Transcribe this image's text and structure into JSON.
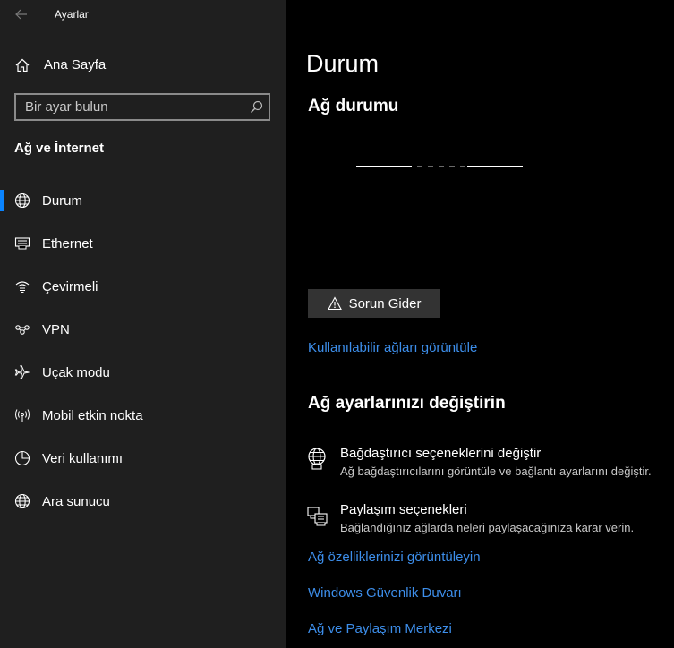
{
  "window": {
    "title": "Ayarlar"
  },
  "sidebar": {
    "home_label": "Ana Sayfa",
    "search": {
      "placeholder": "Bir ayar bulun",
      "value": ""
    },
    "section_title": "Ağ ve İnternet",
    "selected": "Durum",
    "items": [
      {
        "label": "Durum",
        "icon": "globe-icon"
      },
      {
        "label": "Ethernet",
        "icon": "ethernet-icon"
      },
      {
        "label": "Çevirmeli",
        "icon": "dialup-icon"
      },
      {
        "label": "VPN",
        "icon": "vpn-icon"
      },
      {
        "label": "Uçak modu",
        "icon": "airplane-icon"
      },
      {
        "label": "Mobil etkin nokta",
        "icon": "hotspot-icon"
      },
      {
        "label": "Veri kullanımı",
        "icon": "data-usage-icon"
      },
      {
        "label": "Ara sunucu",
        "icon": "proxy-globe-icon"
      }
    ]
  },
  "main": {
    "page_title": "Durum",
    "network_status_title": "Ağ durumu",
    "troubleshoot_label": "Sorun Gider",
    "view_networks_link": "Kullanılabilir ağları görüntüle",
    "change_settings_title": "Ağ ayarlarınızı değiştirin",
    "options": [
      {
        "title": "Bağdaştırıcı seçeneklerini değiştir",
        "description": "Ağ bağdaştırıcılarını görüntüle ve bağlantı ayarlarını değiştir.",
        "icon": "adapter-globe-icon"
      },
      {
        "title": "Paylaşım seçenekleri",
        "description": "Bağlandığınız ağlarda neleri paylaşacağınıza karar verin.",
        "icon": "sharing-icon"
      }
    ],
    "links": [
      "Ağ özelliklerinizi görüntüleyin",
      "Windows Güvenlik Duvarı",
      "Ağ ve Paylaşım Merkezi"
    ]
  },
  "colors": {
    "accent": "#0a84ff",
    "link": "#3d8eea",
    "sidebar_bg": "#1f1f1f",
    "main_bg": "#000000",
    "button_bg": "#333333"
  }
}
